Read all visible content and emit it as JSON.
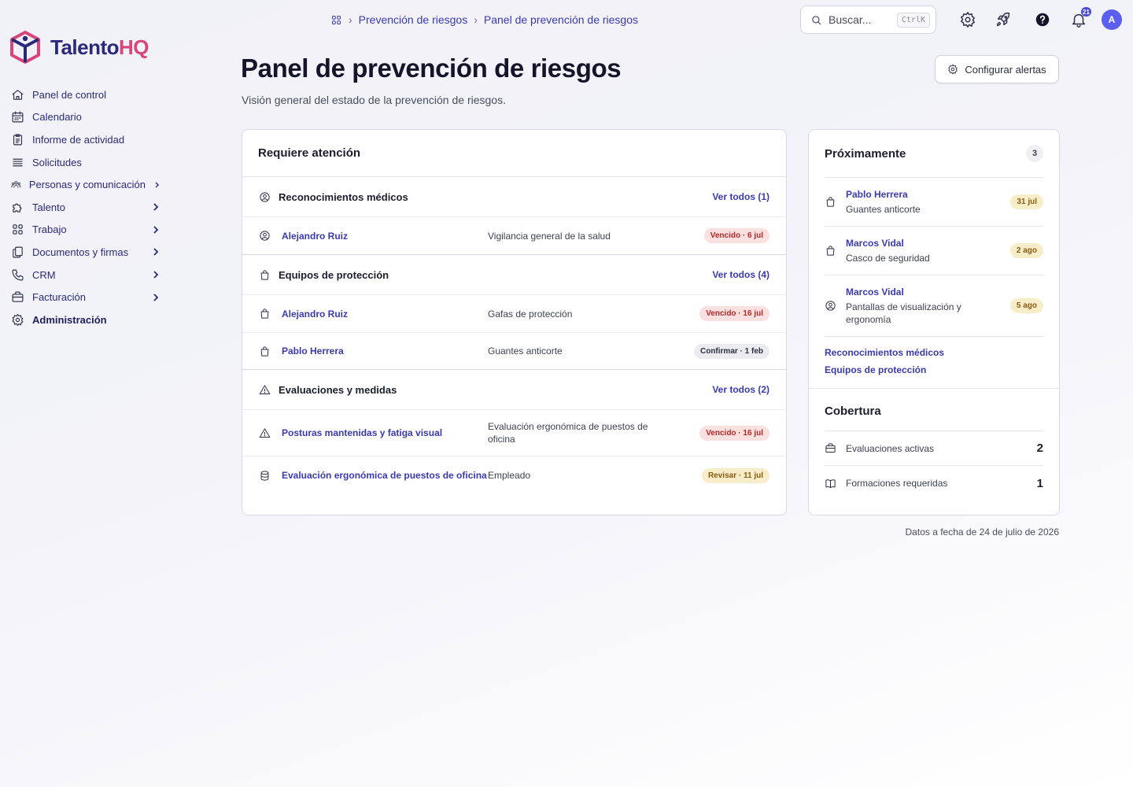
{
  "brand": {
    "name_main": "Talento",
    "name_accent": "HQ",
    "color_primary": "#2a2a7a",
    "color_accent": "#d9457a"
  },
  "sidebar": {
    "items": [
      {
        "label": "Panel de control",
        "icon": "home-icon"
      },
      {
        "label": "Calendario",
        "icon": "calendar-icon"
      },
      {
        "label": "Informe de actividad",
        "icon": "report-icon"
      },
      {
        "label": "Solicitudes",
        "icon": "list-icon"
      },
      {
        "label": "Personas y comunicación",
        "icon": "people-icon"
      },
      {
        "label": "Talento",
        "icon": "puzzle-icon"
      },
      {
        "label": "Trabajo",
        "icon": "grid-icon"
      },
      {
        "label": "Documentos y firmas",
        "icon": "documents-icon"
      },
      {
        "label": "CRM",
        "icon": "phone-icon"
      },
      {
        "label": "Facturación",
        "icon": "briefcase-icon"
      },
      {
        "label": "Administración",
        "icon": "gear-icon"
      }
    ]
  },
  "breadcrumb": {
    "level1": "Prevención de riesgos",
    "level2": "Panel de prevención de riesgos"
  },
  "search": {
    "placeholder": "Buscar...",
    "shortcut": "CtrlK"
  },
  "notifications": {
    "count": "21"
  },
  "user": {
    "initial": "A"
  },
  "header": {
    "title": "Panel de prevención de riesgos",
    "subtitle": "Visión general del estado de la prevención de riesgos.",
    "config_button": "Configurar alertas"
  },
  "attention": {
    "title": "Requiere atención",
    "sections": [
      {
        "title": "Reconocimientos médicos",
        "link": "Ver todos (1)",
        "rows": [
          {
            "name": "Alejandro Ruiz",
            "desc": "Vigilancia general de la salud",
            "status": "Vencido · 6 jul"
          }
        ]
      },
      {
        "title": "Equipos de protección",
        "link": "Ver todos (4)",
        "rows": [
          {
            "name": "Alejandro Ruiz",
            "desc": "Gafas de protección",
            "status": "Vencido · 16 jul"
          },
          {
            "name": "Pablo Herrera",
            "desc": "Guantes anticorte",
            "status": "Confirmar · 1 feb"
          }
        ]
      },
      {
        "title": "Evaluaciones y medidas",
        "link": "Ver todos (2)",
        "rows": [
          {
            "name": "Posturas mantenidas y fatiga visual",
            "desc": "Evaluación ergonómica de puestos de oficina",
            "status": "Vencido · 16 jul"
          },
          {
            "name": "Evaluación ergonómica de puestos de oficina",
            "desc": "Empleado",
            "status": "Revisar · 11 jul"
          }
        ]
      }
    ]
  },
  "upcoming": {
    "title": "Próximamente",
    "count": "3",
    "items": [
      {
        "name": "Pablo Herrera",
        "desc": "Guantes anticorte",
        "date": "31 jul"
      },
      {
        "name": "Marcos Vidal",
        "desc": "Casco de seguridad",
        "date": "2 ago"
      },
      {
        "name": "Marcos Vidal",
        "desc": "Pantallas de visualización y ergonomía",
        "date": "5 ago"
      }
    ],
    "links": [
      "Reconocimientos médicos",
      "Equipos de protección"
    ]
  },
  "coverage": {
    "title": "Cobertura",
    "items": [
      {
        "label": "Evaluaciones activas",
        "value": "2"
      },
      {
        "label": "Formaciones requeridas",
        "value": "1"
      }
    ]
  },
  "footer": {
    "note": "Datos a fecha de 24 de julio de 2026"
  },
  "status_colors": {
    "overdue": "#b42828",
    "confirm": "#2c2e40",
    "review": "#8a5a10",
    "link": "#3a3ab0"
  }
}
